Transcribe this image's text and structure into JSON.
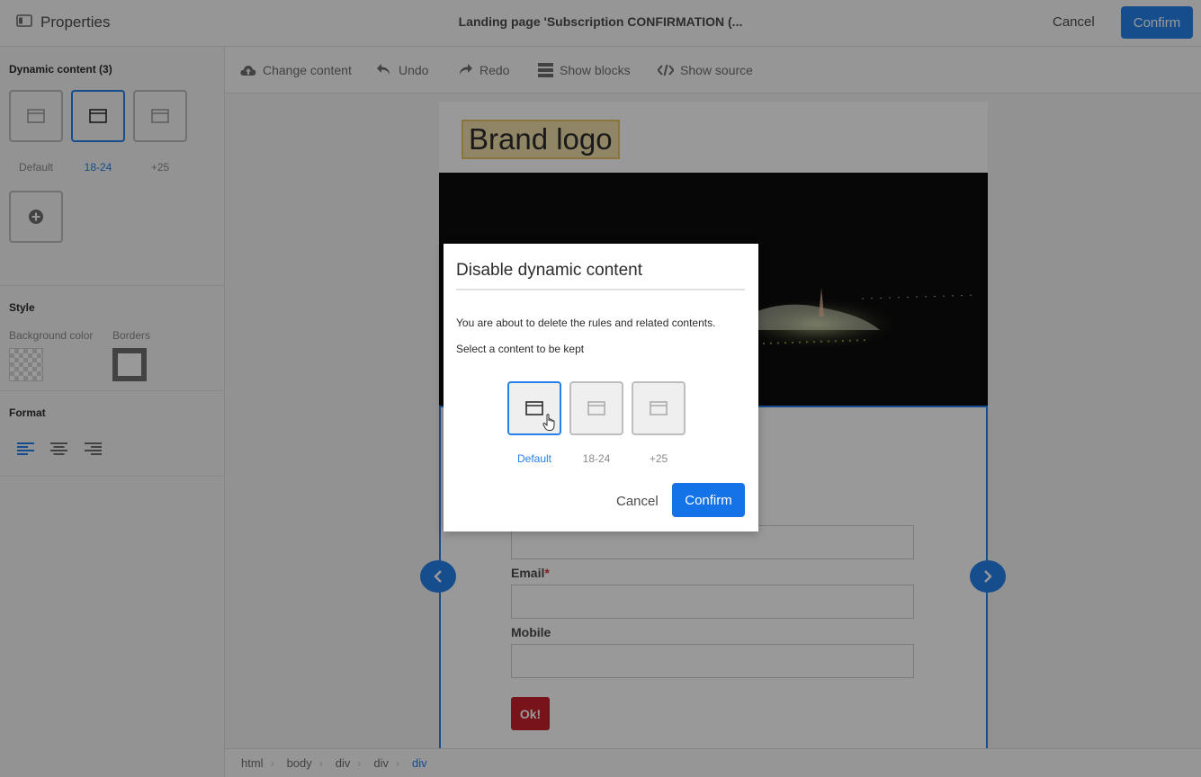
{
  "topbar": {
    "panel_title": "Properties",
    "document_title": "Landing page 'Subscription CONFIRMATION (...",
    "cancel_label": "Cancel",
    "confirm_label": "Confirm"
  },
  "left_panel": {
    "dynamic_content": {
      "title": "Dynamic content (3)",
      "variants": [
        {
          "label": "Default",
          "selected": false
        },
        {
          "label": "18-24",
          "selected": true
        },
        {
          "label": "+25",
          "selected": false
        }
      ]
    },
    "style": {
      "title": "Style",
      "background_color_label": "Background color",
      "borders_label": "Borders"
    },
    "format": {
      "title": "Format"
    }
  },
  "toolbar": {
    "change_content": "Change content",
    "undo": "Undo",
    "redo": "Redo",
    "show_blocks": "Show blocks",
    "show_source": "Show source"
  },
  "page": {
    "brand_logo": "Brand logo",
    "fields": [
      {
        "label": "Email",
        "required": "*"
      },
      {
        "label": "Mobile"
      }
    ],
    "ok_button": "Ok!"
  },
  "breadcrumb": [
    "html",
    "body",
    "div",
    "div",
    "div"
  ],
  "dialog": {
    "title": "Disable dynamic content",
    "message": "You are about to delete the rules and related contents.",
    "instruction": "Select a content to be kept",
    "options": [
      {
        "label": "Default",
        "selected": true
      },
      {
        "label": "18-24",
        "selected": false
      },
      {
        "label": "+25",
        "selected": false
      }
    ],
    "cancel_label": "Cancel",
    "confirm_label": "Confirm"
  },
  "colors": {
    "accent": "#2680eb",
    "ok_button": "#c8202a"
  }
}
